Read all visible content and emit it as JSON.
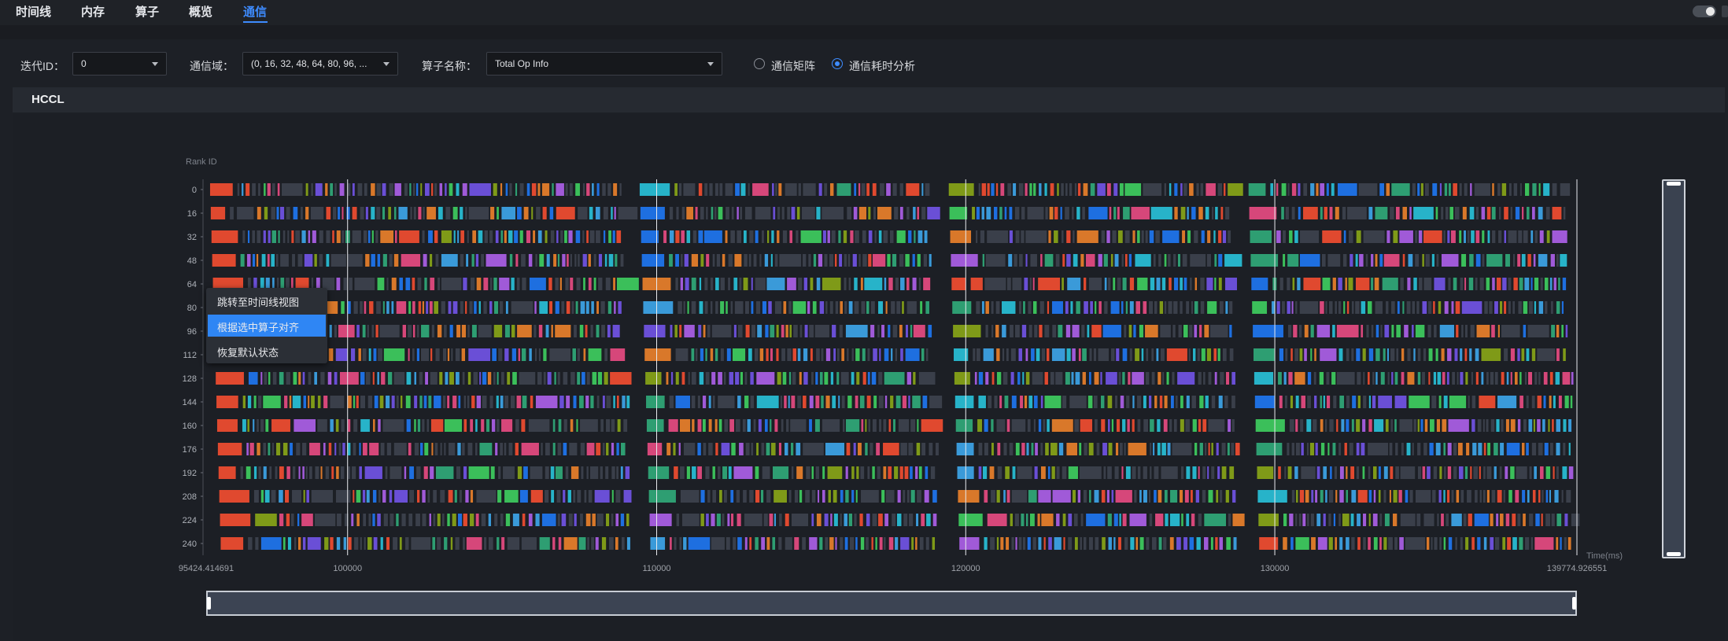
{
  "nav": {
    "tabs": [
      {
        "label": "时间线",
        "active": false
      },
      {
        "label": "内存",
        "active": false
      },
      {
        "label": "算子",
        "active": false
      },
      {
        "label": "概览",
        "active": false
      },
      {
        "label": "通信",
        "active": true
      }
    ],
    "theme_toggle": {
      "on": true
    }
  },
  "filters": {
    "iteration": {
      "label": "迭代ID：",
      "value": "0"
    },
    "comm_domain": {
      "label": "通信域：",
      "value": "(0, 16, 32, 48, 64, 80, 96, ..."
    },
    "operator": {
      "label": "算子名称：",
      "value": "Total Op Info"
    },
    "view_mode": {
      "options": [
        "通信矩阵",
        "通信耗时分析"
      ],
      "selected": "通信耗时分析"
    }
  },
  "section": {
    "title": "HCCL"
  },
  "context_menu": {
    "items": [
      "跳转至时间线视图",
      "根据选中算子对齐",
      "恢复默认状态"
    ],
    "highlighted": "根据选中算子对齐"
  },
  "chart_data": {
    "type": "timeline",
    "ylabel": "Rank ID",
    "xlabel": "Time(ms)",
    "ranks": [
      "0",
      "16",
      "32",
      "48",
      "64",
      "80",
      "96",
      "112",
      "128",
      "144",
      "160",
      "176",
      "192",
      "208",
      "224",
      "240"
    ],
    "x_tick_labels": [
      "95424.414691",
      "100000",
      "110000",
      "120000",
      "130000",
      "139774.926551"
    ],
    "xlim": [
      95424.414691,
      139774.926551
    ],
    "palette": [
      "#e0492f",
      "#1e6fe0",
      "#2e9e72",
      "#d6477a",
      "#7f9a18",
      "#d9782a",
      "#3a9ad9",
      "#6a4fd6",
      "#27b3c9",
      "#a05ad8",
      "#3bbf5a"
    ]
  }
}
